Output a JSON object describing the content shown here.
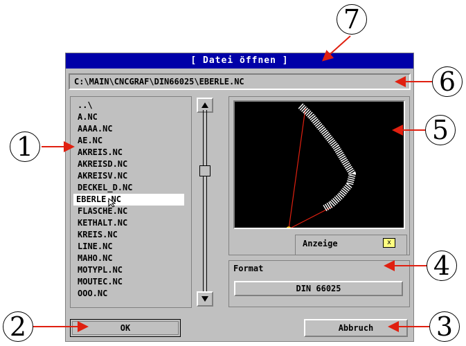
{
  "dialog": {
    "title": "[ Datei öffnen ]",
    "path": "C:\\MAIN\\CNCGRAF\\DIN66025\\EBERLE.NC"
  },
  "files": [
    "..\\",
    "A.NC",
    "AAAA.NC",
    "AE.NC",
    "AKREIS.NC",
    "AKREISD.NC",
    "AKREISV.NC",
    "DECKEL_D.NC",
    "EBERLE.NC",
    "FLASCHE.NC",
    "KETHALT.NC",
    "KREIS.NC",
    "LINE.NC",
    "MAHO.NC",
    "MOTYPL.NC",
    "MOUTEC.NC",
    "OOO.NC"
  ],
  "selected_file": "EBERLE.NC",
  "scroll": {
    "up_icon": "arrow-up-icon",
    "down_icon": "arrow-down-icon",
    "position": 0.3
  },
  "preview": {
    "label": "Anzeige",
    "check": "x"
  },
  "format": {
    "label": "Format",
    "value": "DIN 66025"
  },
  "buttons": {
    "ok": "OK",
    "cancel": "Abbruch"
  },
  "callouts": [
    "1",
    "2",
    "3",
    "4",
    "5",
    "6",
    "7"
  ],
  "colors": {
    "titlebar": "#0000a8",
    "dialog": "#c0c0c0",
    "preview_bg": "#000000",
    "callout_arrow": "#e02010"
  }
}
